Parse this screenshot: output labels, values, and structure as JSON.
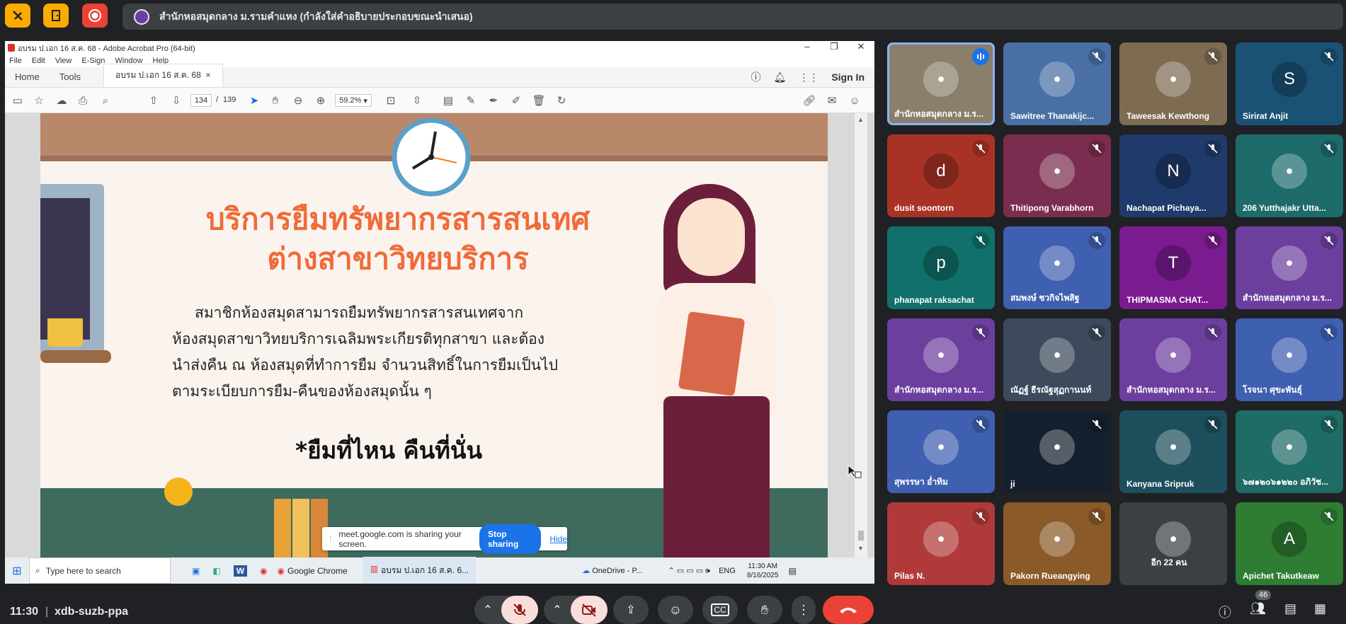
{
  "meeting": {
    "presenter_label": "สำนักหอสมุดกลาง ม.รามคำแหง (กำลังใส่คำอธิบายประกอบขณะนำเสนอ)",
    "time": "11:30",
    "code": "xdb-suzb-ppa",
    "people_count": "46"
  },
  "acrobat": {
    "window_title": "อบรม ป.เอก 16 ส.ค. 68 - Adobe Acrobat Pro (64-bit)",
    "menu": [
      "File",
      "Edit",
      "View",
      "E-Sign",
      "Window",
      "Help"
    ],
    "tab_home": "Home",
    "tab_tools": "Tools",
    "doc_tab": "อบรม ป.เอก 16 ส.ค. 68",
    "sign_in": "Sign In",
    "page_current": "134",
    "page_sep": "/",
    "page_total": "139",
    "zoom": "59.2%"
  },
  "slide": {
    "title_line1": "บริการยืมทรัพยากรสารสนเทศ",
    "title_line2": "ต่างสาขาวิทยบริการ",
    "body_lines": [
      "สมาชิกห้องสมุดสามารถยืมทรัพยากรสารสนเทศจาก",
      "ห้องสมุดสาขาวิทยบริการเฉลิมพระเกียรติทุกสาขา และต้อง",
      "นำส่งคืน ณ ห้องสมุดที่ทำการยืม จำนวนสิทธิ์ในการยืมเป็นไป",
      "ตามระเบียบการยืม-คืนของห้องสมุดนั้น ๆ"
    ],
    "tagline": "*ยืมที่ไหน คืนที่นั่น"
  },
  "share_banner": {
    "text": "meet.google.com is sharing your screen.",
    "stop": "Stop sharing",
    "hide": "Hide"
  },
  "taskbar": {
    "search_placeholder": "Type here to search",
    "chrome_label": "Google Chrome",
    "acrobat_label": "อบรม ป.เอก 16 ส.ค. 6...",
    "onedrive": "OneDrive - P...",
    "lang": "ENG",
    "clock_time": "11:30 AM",
    "clock_date": "8/16/2025"
  },
  "participants": [
    {
      "name": "สำนักหอสมุดกลาง ม.ร...",
      "initial": "",
      "bg": "#8a7f6a"
    },
    {
      "name": "Sawitree Thanakijc...",
      "initial": "",
      "bg": "#4a6fa5"
    },
    {
      "name": "Taweesak Kewthong",
      "initial": "",
      "bg": "#7d6b52"
    },
    {
      "name": "Sirirat Anjit",
      "initial": "S",
      "bg": "#1a5276"
    },
    {
      "name": "dusit soontorn",
      "initial": "d",
      "bg": "#a93226"
    },
    {
      "name": "Thitipong Varabhorn",
      "initial": "",
      "bg": "#7b2d4f"
    },
    {
      "name": "Nachapat Pichaya...",
      "initial": "N",
      "bg": "#1f3a6b"
    },
    {
      "name": "206 Yutthajakr Utta...",
      "initial": "",
      "bg": "#1d6b6b"
    },
    {
      "name": "phanapat raksachat",
      "initial": "p",
      "bg": "#11706b"
    },
    {
      "name": "สมพงษ์ ชวกิจไพสิฐ",
      "initial": "",
      "bg": "#3f5fb0"
    },
    {
      "name": "THIPMASNA CHAT...",
      "initial": "T",
      "bg": "#7a1b8f"
    },
    {
      "name": "สำนักหอสมุดกลาง ม.ร...",
      "initial": "",
      "bg": "#6c3f9e"
    },
    {
      "name": "สำนักหอสมุดกลาง ม.ร...",
      "initial": "",
      "bg": "#6c3f9e"
    },
    {
      "name": "ณัฏฐ์ ธีรณัฐสุฏกานนท์",
      "initial": "",
      "bg": "#3c4a5c"
    },
    {
      "name": "สำนักหอสมุดกลาง ม.ร...",
      "initial": "",
      "bg": "#6c3f9e"
    },
    {
      "name": "โรจนา ศุขะพันธุ์",
      "initial": "",
      "bg": "#3f5fb0"
    },
    {
      "name": "สุพรรษา อ่ำทิม",
      "initial": "",
      "bg": "#3f5fb0"
    },
    {
      "name": "ji",
      "initial": "",
      "bg": "#15202e"
    },
    {
      "name": "Kanyana Sripruk",
      "initial": "",
      "bg": "#1c4e5c"
    },
    {
      "name": "๖๗๑๒๐๖๑๒๒๐ อภิวัช...",
      "initial": "",
      "bg": "#1f6b66"
    },
    {
      "name": "Pilas N.",
      "initial": "",
      "bg": "#b03a3a"
    },
    {
      "name": "Pakorn Rueangying",
      "initial": "",
      "bg": "#8a5a28"
    },
    {
      "name": "อีก 22 คน",
      "initial": "",
      "bg": "#3c4043"
    },
    {
      "name": "Apichet Takutkeaw",
      "initial": "A",
      "bg": "#2e7d32"
    }
  ]
}
